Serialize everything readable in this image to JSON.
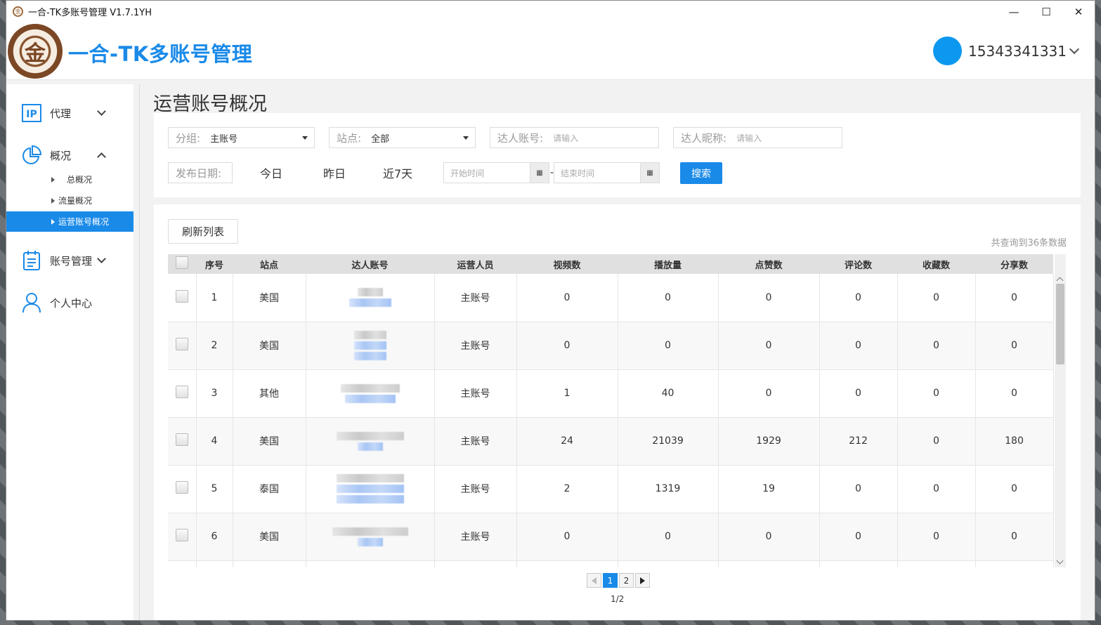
{
  "window": {
    "title": "一合-TK多账号管理 V1.7.1YH",
    "minimize": "—",
    "maximize": "☐",
    "close": "✕"
  },
  "header": {
    "app_title": "一合-TK多账号管理",
    "username": "15343341331"
  },
  "sidebar": {
    "items": [
      {
        "label": "代理",
        "icon": "ip-icon"
      },
      {
        "label": "概况",
        "icon": "pie-chart-icon"
      },
      {
        "label": "账号管理",
        "icon": "clipboard-icon"
      },
      {
        "label": "个人中心",
        "icon": "user-icon"
      }
    ],
    "sub_items": [
      "总概况",
      "流量概况",
      "运营账号概况"
    ],
    "active_sub": "运营账号概况",
    "accent_color": "#1a8ae8"
  },
  "page": {
    "title": "运营账号概况"
  },
  "filters": {
    "group_label": "分组:",
    "group_value": "主账号",
    "site_label": "站点:",
    "site_value": "全部",
    "account_label": "达人账号:",
    "account_placeholder": "请输入",
    "nickname_label": "达人昵称:",
    "nickname_placeholder": "请输入",
    "date_label": "发布日期:",
    "quick_today": "今日",
    "quick_yesterday": "昨日",
    "quick_7days": "近7天",
    "start_placeholder": "开始时间",
    "end_placeholder": "结束时间",
    "date_sep": "-",
    "search_button": "搜索"
  },
  "table": {
    "refresh_button": "刷新列表",
    "total_text": "共查询到36条数据",
    "columns": [
      "序号",
      "站点",
      "达人账号",
      "运营人员",
      "视频数",
      "播放量",
      "点赞数",
      "评论数",
      "收藏数",
      "分享数"
    ],
    "rows": [
      {
        "no": "1",
        "site": "美国",
        "operator": "主账号",
        "videos": "0",
        "plays": "0",
        "likes": "0",
        "comments": "0",
        "favorites": "0",
        "shares": "0"
      },
      {
        "no": "2",
        "site": "美国",
        "operator": "主账号",
        "videos": "0",
        "plays": "0",
        "likes": "0",
        "comments": "0",
        "favorites": "0",
        "shares": "0"
      },
      {
        "no": "3",
        "site": "其他",
        "operator": "主账号",
        "videos": "1",
        "plays": "40",
        "likes": "0",
        "comments": "0",
        "favorites": "0",
        "shares": "0"
      },
      {
        "no": "4",
        "site": "美国",
        "operator": "主账号",
        "videos": "24",
        "plays": "21039",
        "likes": "1929",
        "comments": "212",
        "favorites": "0",
        "shares": "180"
      },
      {
        "no": "5",
        "site": "泰国",
        "operator": "主账号",
        "videos": "2",
        "plays": "1319",
        "likes": "19",
        "comments": "0",
        "favorites": "0",
        "shares": "0"
      },
      {
        "no": "6",
        "site": "美国",
        "operator": "主账号",
        "videos": "0",
        "plays": "0",
        "likes": "0",
        "comments": "0",
        "favorites": "0",
        "shares": "0"
      }
    ]
  },
  "pagination": {
    "pages": [
      "1",
      "2"
    ],
    "current": "1",
    "info": "1/2"
  }
}
